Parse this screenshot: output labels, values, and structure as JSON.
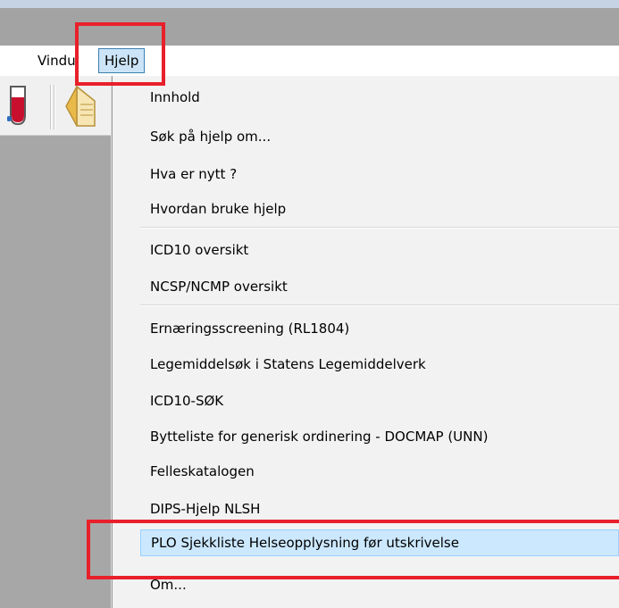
{
  "menubar": {
    "items": [
      {
        "label": ":"
      },
      {
        "label": "Vindu"
      },
      {
        "label": "Hjelp"
      }
    ]
  },
  "help_menu": {
    "items": [
      {
        "label": "Innhold"
      },
      {
        "label": "Søk på hjelp om..."
      },
      {
        "label": "Hva er nytt ?"
      },
      {
        "label": "Hvordan bruke hjelp"
      },
      {
        "label": "ICD10 oversikt"
      },
      {
        "label": "NCSP/NCMP oversikt"
      },
      {
        "label": "Ernæringsscreening (RL1804)"
      },
      {
        "label": "Legemiddelsøk i Statens Legemiddelverk"
      },
      {
        "label": "ICD10-SØK"
      },
      {
        "label": "Bytteliste for generisk ordinering - DOCMAP (UNN)"
      },
      {
        "label": "Felleskatalogen"
      },
      {
        "label": "DIPS-Hjelp NLSH"
      },
      {
        "label": "PLO Sjekkliste Helseopplysning før utskrivelse"
      },
      {
        "label": "Om..."
      }
    ]
  },
  "toolbar": {
    "icons": [
      "test-tube-icon",
      "document-icon"
    ]
  },
  "colors": {
    "highlight": "#cce8ff",
    "highlight_border": "#99d1ff",
    "annotation_red": "#e8202a",
    "menu_background": "#f2f2f2",
    "workspace": "#a7a7a7"
  }
}
